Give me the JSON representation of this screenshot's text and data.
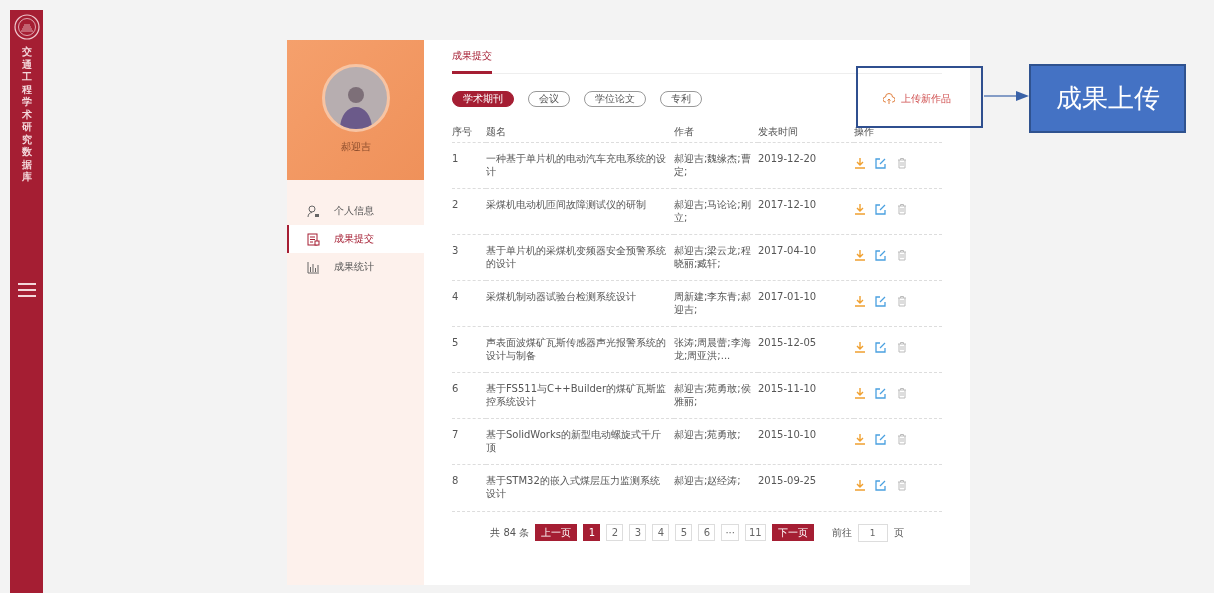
{
  "sidebar": {
    "title": "交通工程学术研究数据库"
  },
  "profile": {
    "name": "郝迎吉"
  },
  "menu": [
    {
      "kind": "person",
      "label": "个人信息",
      "selected": false
    },
    {
      "kind": "document",
      "label": "成果提交",
      "selected": true
    },
    {
      "kind": "chart",
      "label": "成果统计",
      "selected": false
    }
  ],
  "tabs": [
    {
      "label": "成果提交",
      "selected": true
    }
  ],
  "categories": [
    {
      "label": "学术期刊",
      "selected": true
    },
    {
      "label": "会议",
      "selected": false
    },
    {
      "label": "学位论文",
      "selected": false
    },
    {
      "label": "专利",
      "selected": false
    }
  ],
  "upload_link": "上传新作品",
  "table": {
    "columns": [
      "序号",
      "题名",
      "作者",
      "发表时间",
      "操作"
    ],
    "rows": [
      {
        "index": "1",
        "title": "一种基于单片机的电动汽车充电系统的设计",
        "authors": "郝迎吉;魏缘杰;曹定;",
        "date": "2019-12-20"
      },
      {
        "index": "2",
        "title": "采煤机电动机匝间故障测试仪的研制",
        "authors": "郝迎吉;马论论;刚立;",
        "date": "2017-12-10"
      },
      {
        "index": "3",
        "title": "基于单片机的采煤机变频器安全预警系统的设计",
        "authors": "郝迎吉;梁云龙;程晓丽;臧轩;",
        "date": "2017-04-10"
      },
      {
        "index": "4",
        "title": "采煤机制动器试验台检测系统设计",
        "authors": "周新建;李东青;郝迎吉;",
        "date": "2017-01-10"
      },
      {
        "index": "5",
        "title": "声表面波煤矿瓦斯传感器声光报警系统的设计与制备",
        "authors": "张涛;周晨蕾;李海龙;周亚洪;...",
        "date": "2015-12-05"
      },
      {
        "index": "6",
        "title": "基于FS511与C++Builder的煤矿瓦斯监控系统设计",
        "authors": "郝迎吉;苑勇敢;侯雅丽;",
        "date": "2015-11-10"
      },
      {
        "index": "7",
        "title": "基于SolidWorks的新型电动螺旋式千斤顶",
        "authors": "郝迎吉;苑勇敢;",
        "date": "2015-10-10"
      },
      {
        "index": "8",
        "title": "基于STM32的嵌入式煤层压力监测系统设计",
        "authors": "郝迎吉;赵经涛;",
        "date": "2015-09-25"
      }
    ]
  },
  "pagination": {
    "total": "共 84 条",
    "prev": "上一页",
    "next": "下一页",
    "pages": [
      {
        "label": "1",
        "selected": true
      },
      {
        "label": "2",
        "selected": false
      },
      {
        "label": "3",
        "selected": false
      },
      {
        "label": "4",
        "selected": false
      },
      {
        "label": "5",
        "selected": false
      },
      {
        "label": "6",
        "selected": false
      },
      {
        "label": "···",
        "selected": false
      },
      {
        "label": "11",
        "selected": false
      }
    ],
    "goto_label": "前往",
    "goto_value": "1",
    "goto_unit": "页"
  },
  "annotation": {
    "label": "成果上传"
  }
}
